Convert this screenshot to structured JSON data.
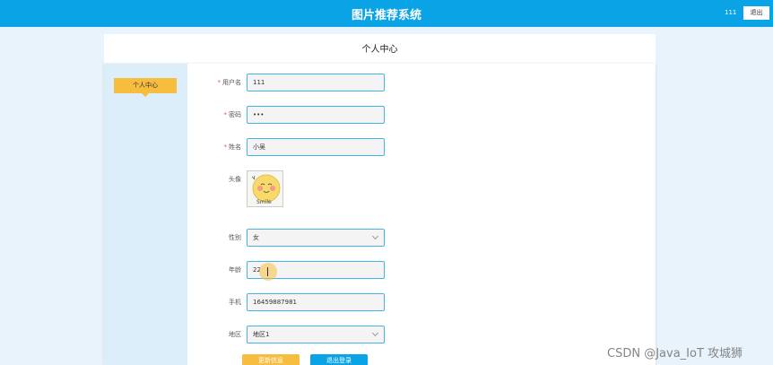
{
  "app": {
    "title": "图片推荐系统",
    "username": "111",
    "logout_label": "退出"
  },
  "page": {
    "title": "个人中心"
  },
  "sidebar": {
    "items": [
      {
        "label": "个人中心"
      }
    ]
  },
  "form": {
    "username": {
      "label": "用户名",
      "required": "*",
      "value": "111"
    },
    "password": {
      "label": "密码",
      "required": "*",
      "value": "•••"
    },
    "name": {
      "label": "姓名",
      "required": "*",
      "value": "小吴"
    },
    "avatar": {
      "label": "头像",
      "image_text": "Smile"
    },
    "gender": {
      "label": "性别",
      "value": "女"
    },
    "age": {
      "label": "年龄",
      "value": "22"
    },
    "phone": {
      "label": "手机",
      "value": "16459887981"
    },
    "region": {
      "label": "地区",
      "value": "地区1"
    }
  },
  "actions": {
    "update_label": "更新信息",
    "logout_label": "退出登录"
  },
  "watermark": "CSDN @Java_IoT 攻城狮",
  "colors": {
    "primary": "#0aa3e6",
    "accent": "#f7bd3f",
    "sidebar_bg": "#dbeefa",
    "required": "#e3544a"
  }
}
